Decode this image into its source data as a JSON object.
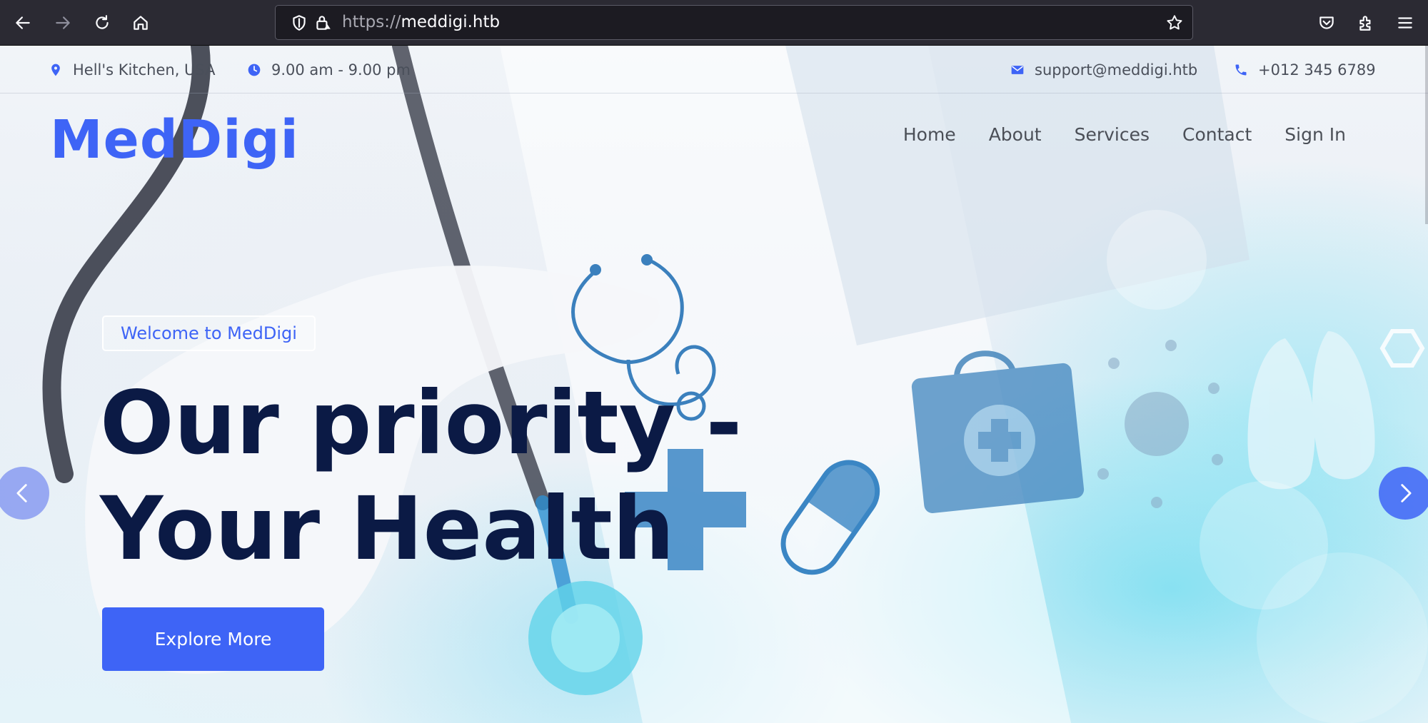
{
  "browser": {
    "url_scheme": "https://",
    "url_host": "meddigi.htb",
    "icons": [
      "back-icon",
      "forward-icon",
      "reload-icon",
      "home-icon",
      "shield-icon",
      "lock-icon",
      "bookmark-star-icon",
      "pocket-icon",
      "extensions-icon",
      "menu-icon"
    ]
  },
  "topbar": {
    "location": "Hell's Kitchen, USA",
    "hours": "9.00 am - 9.00 pm",
    "email": "support@meddigi.htb",
    "phone": "+012 345 6789"
  },
  "brand": "MedDigi",
  "nav": {
    "items": [
      {
        "label": "Home"
      },
      {
        "label": "About"
      },
      {
        "label": "Services"
      },
      {
        "label": "Contact"
      },
      {
        "label": "Sign In"
      }
    ]
  },
  "hero": {
    "badge": "Welcome to MedDigi",
    "headline_line1": "Our priority -",
    "headline_line2": "Your Health",
    "cta": "Explore More"
  },
  "colors": {
    "accent": "#3e64f6",
    "headline": "#0b1a45",
    "chrome": "#2b2a33"
  }
}
